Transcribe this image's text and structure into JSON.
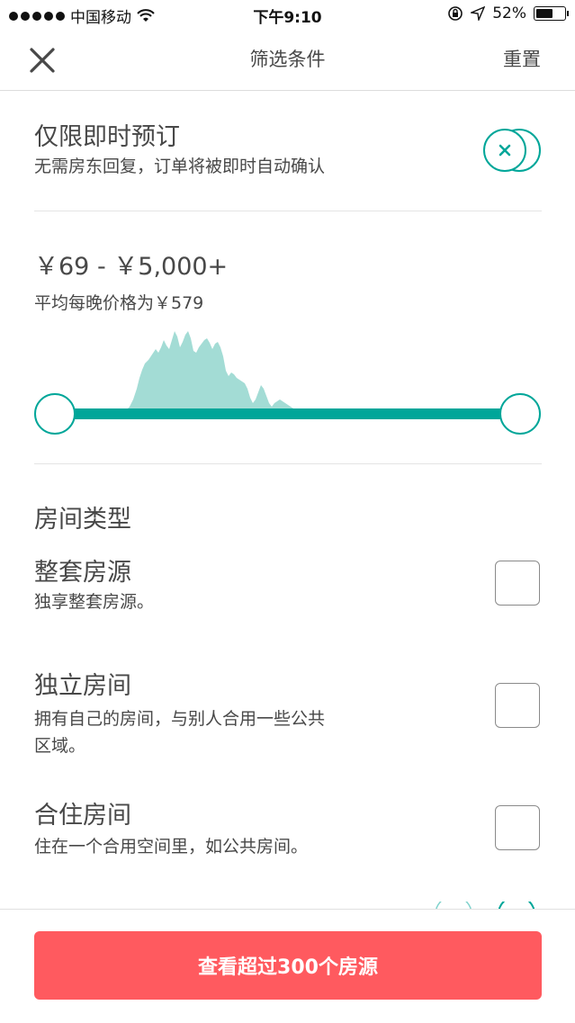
{
  "status_bar": {
    "carrier": "中国移动",
    "time": "下午9:10",
    "battery": "52%",
    "battery_level": 0.52,
    "icons": [
      "signal-dots-icon",
      "wifi-icon",
      "rotation-lock-icon",
      "location-arrow-icon",
      "battery-icon"
    ]
  },
  "nav": {
    "title": "筛选条件",
    "reset_label": "重置",
    "close_icon": "close-icon"
  },
  "instant_book": {
    "title": "仅限即时预订",
    "description": "无需房东回复，订单将被即时自动确认",
    "enabled": false,
    "toggle_icon": "x-icon"
  },
  "price": {
    "range_label": "￥69 - ￥5,000+",
    "average_label": "平均每晚价格为￥579",
    "min": 69,
    "max": 5000
  },
  "room_type": {
    "heading": "房间类型",
    "options": [
      {
        "title": "整套房源",
        "description": "独享整套房源。",
        "checked": false
      },
      {
        "title": "独立房间",
        "description_line1": "拥有自己的房间，与别人合用一些公共",
        "description_line2": "区域。",
        "checked": false
      },
      {
        "title": "合住房间",
        "description": "住在一个合用空间里，如公共房间。",
        "checked": false
      }
    ]
  },
  "footer": {
    "cta_label": "查看超过300个房源"
  },
  "colors": {
    "accent": "#00a699",
    "histogram": "#a3dcd5",
    "cta": "#ff5a5f",
    "text": "#484848"
  }
}
